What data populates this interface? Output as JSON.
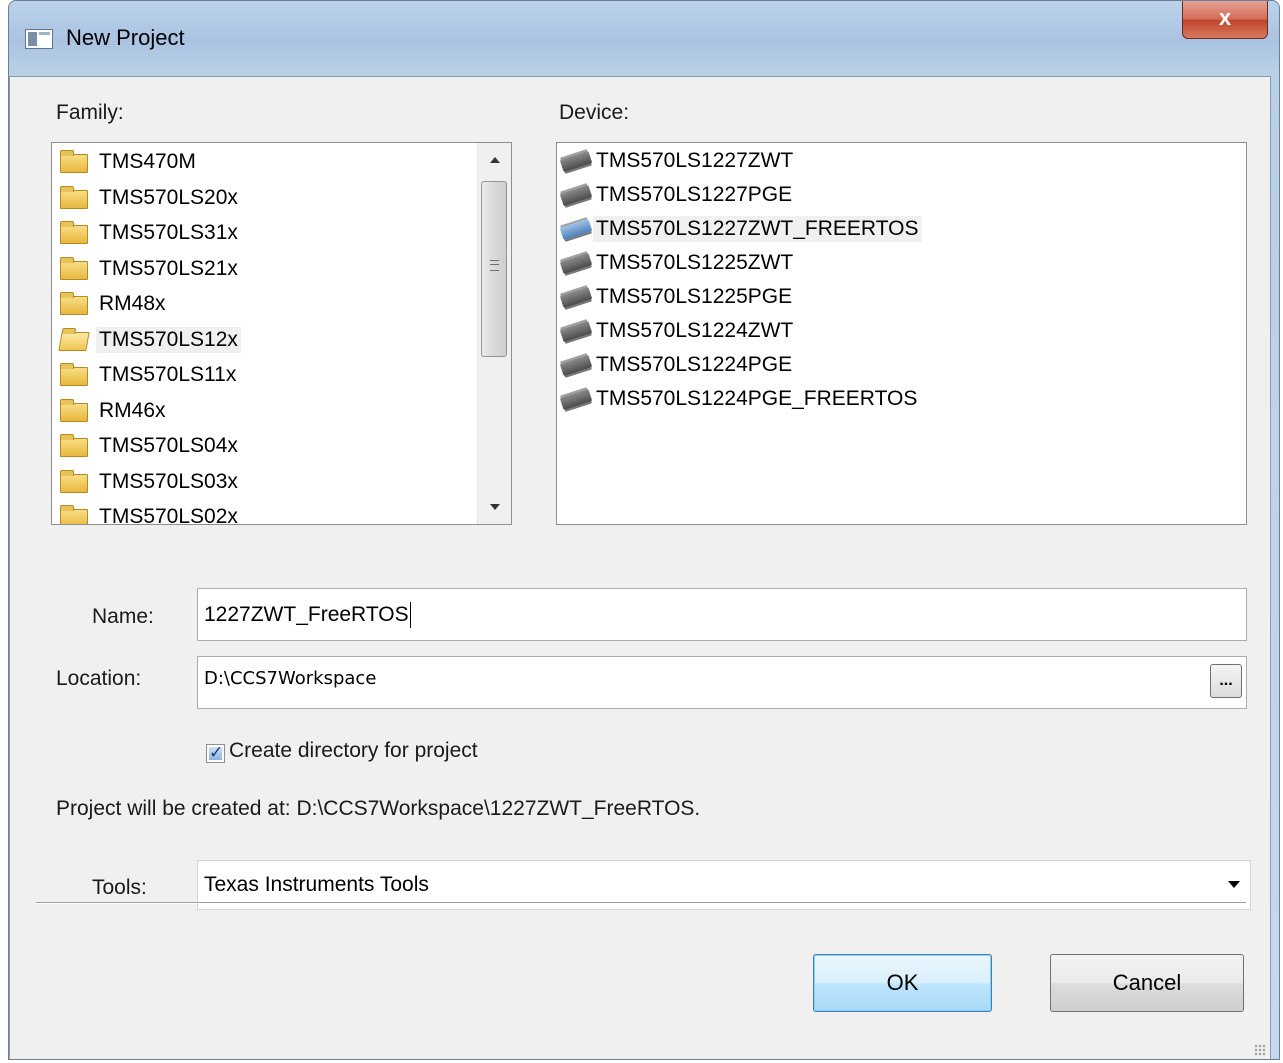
{
  "window": {
    "title": "New Project",
    "close_glyph": "x"
  },
  "family": {
    "label": "Family:",
    "items": [
      "TMS470M",
      "TMS570LS20x",
      "TMS570LS31x",
      "TMS570LS21x",
      "RM48x",
      "TMS570LS12x",
      "TMS570LS11x",
      "RM46x",
      "TMS570LS04x",
      "TMS570LS03x",
      "TMS570LS02x"
    ],
    "selected": "TMS570LS12x"
  },
  "device": {
    "label": "Device:",
    "items": [
      "TMS570LS1227ZWT",
      "TMS570LS1227PGE",
      "TMS570LS1227ZWT_FREERTOS",
      "TMS570LS1225ZWT",
      "TMS570LS1225PGE",
      "TMS570LS1224ZWT",
      "TMS570LS1224PGE",
      "TMS570LS1224PGE_FREERTOS"
    ],
    "selected": "TMS570LS1227ZWT_FREERTOS"
  },
  "name": {
    "label": "Name:",
    "value": "1227ZWT_FreeRTOS"
  },
  "location": {
    "label": "Location:",
    "value": "D:\\CCS7Workspace",
    "browse_label": "..."
  },
  "create_dir": {
    "label": "Create directory for project",
    "checked": true
  },
  "summary": "Project will be created at: D:\\CCS7Workspace\\1227ZWT_FreeRTOS.",
  "tools": {
    "label": "Tools:",
    "value": "Texas Instruments Tools"
  },
  "buttons": {
    "ok": "OK",
    "cancel": "Cancel"
  },
  "icons": {
    "folder": "folder-icon",
    "chip": "chip-icon"
  }
}
